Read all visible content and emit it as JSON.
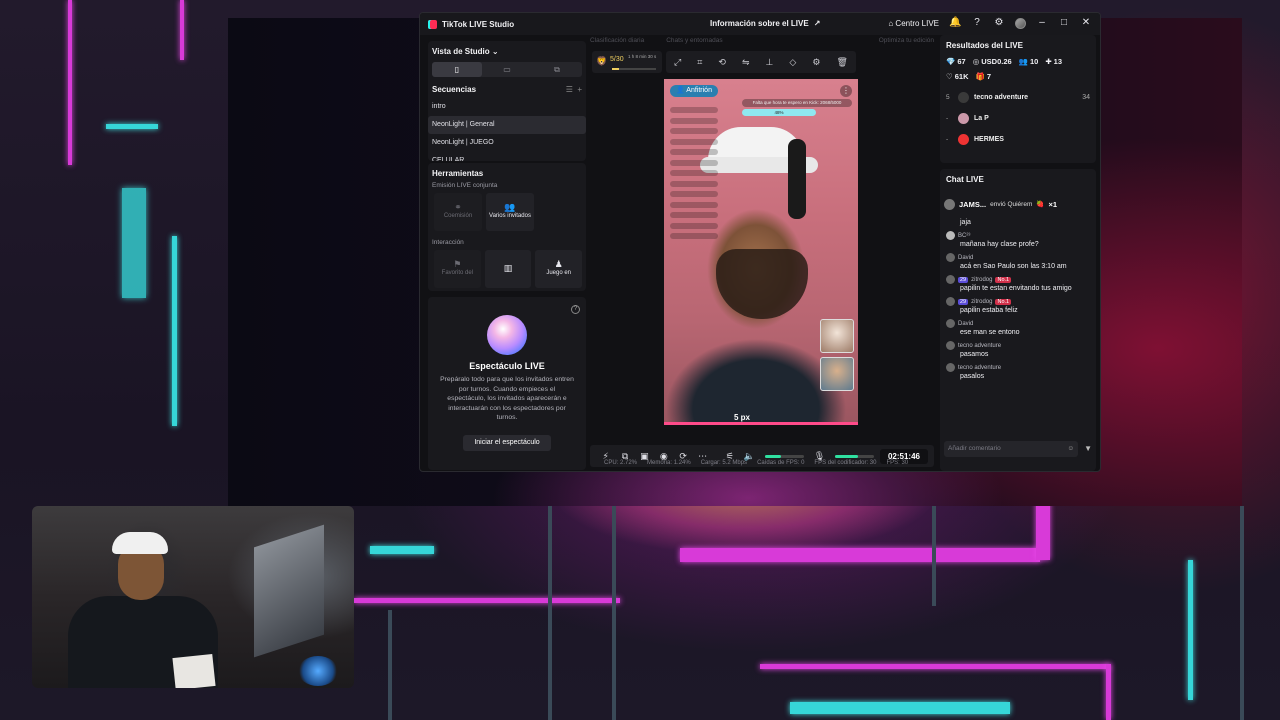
{
  "window": {
    "app_title": "TikTok LIVE Studio",
    "center_title": "Información sobre el LIVE",
    "center_link": "Centro LIVE"
  },
  "left": {
    "studio_view": "Vista de Studio",
    "sequences_title": "Secuencias",
    "sequences": [
      "intro",
      "NeonLight | General",
      "NeonLight | JUEGO",
      "CELULAR"
    ],
    "selected_sequence": "NeonLight | General",
    "tools_title": "Herramientas",
    "coop_section": "Emisión LIVE conjunta",
    "coop_tools": [
      {
        "label": "Coemisión",
        "enabled": false
      },
      {
        "label": "Varios invitados",
        "enabled": true
      }
    ],
    "interaction_section": "Interacción",
    "interaction_tools": [
      {
        "label": "Favorito del",
        "enabled": false
      },
      {
        "label": "",
        "enabled": true
      },
      {
        "label": "Juego en",
        "enabled": true
      }
    ],
    "show_title": "Espectáculo LIVE",
    "show_desc": "Prepáralo todo para que los invitados entren por turnos. Cuando empieces el espectáculo, los invitados aparecerán e interactuarán con los espectadores por turnos.",
    "show_button": "Iniciar el espectáculo"
  },
  "center": {
    "tabs": [
      "Clasificación diaria",
      "Chats y entornadas",
      "Optimiza tu edición"
    ],
    "goal_count": "5/30",
    "goal_timer": "1 h 8 min 30 s",
    "goal_progress": 0.17,
    "host_label": "Anfitrión",
    "overlay_banner": "Falta que hora te espero en Kick: 2068/5000",
    "overlay_progress": "48%",
    "px_label": "5 px",
    "timer": "02:51:46",
    "volume_level": 0.4,
    "mic_level": 0.6,
    "status": {
      "cpu": "CPU: 2.72%",
      "memory": "Memoria: 1.24%",
      "load": "Cargar: 5.2 Mbps",
      "fps_drops": "Caídas de FPS: 0",
      "encoder_fps": "FPS del codificador: 30",
      "fps": "FPS: 30"
    }
  },
  "right": {
    "results_title": "Resultados del LIVE",
    "stats": [
      {
        "icon": "diamond-icon",
        "value": "67"
      },
      {
        "icon": "coin-icon",
        "value": "USD0.26"
      },
      {
        "icon": "viewers-icon",
        "value": "10"
      },
      {
        "icon": "new-followers-icon",
        "value": "13"
      },
      {
        "icon": "heart-icon",
        "value": "61K"
      },
      {
        "icon": "gift-icon",
        "value": "7"
      }
    ],
    "ranking": [
      {
        "rank": "5",
        "name": "tecno adventure",
        "score": "34"
      },
      {
        "rank": "-",
        "name": "La P",
        "score": ""
      },
      {
        "rank": "-",
        "name": "HERMES",
        "score": ""
      }
    ],
    "chat_title": "Chat LIVE",
    "gift_event": {
      "user": "JAMS...",
      "action": "envió Quiérem",
      "count": "×1"
    },
    "messages": [
      {
        "user": "",
        "badges": [],
        "text": "jaja"
      },
      {
        "user": "BC²³",
        "badges": [],
        "text": "mañana hay clase profe?"
      },
      {
        "user": "David",
        "badges": [],
        "text": "acá en Sao Paulo son las 3:10 am"
      },
      {
        "user": "zitrodog",
        "badges": [
          "29",
          "No.1"
        ],
        "text": "papilin te estan envitando tus amigo"
      },
      {
        "user": "zitrodog",
        "badges": [
          "29",
          "No.1"
        ],
        "text": "papilin estaba feliz"
      },
      {
        "user": "David",
        "badges": [],
        "text": "ese man se entono"
      },
      {
        "user": "tecno adventure",
        "badges": [],
        "text": "pasamos"
      },
      {
        "user": "tecno adventure",
        "badges": [],
        "text": "pasalos"
      }
    ],
    "comment_placeholder": "Añadir comentario"
  }
}
